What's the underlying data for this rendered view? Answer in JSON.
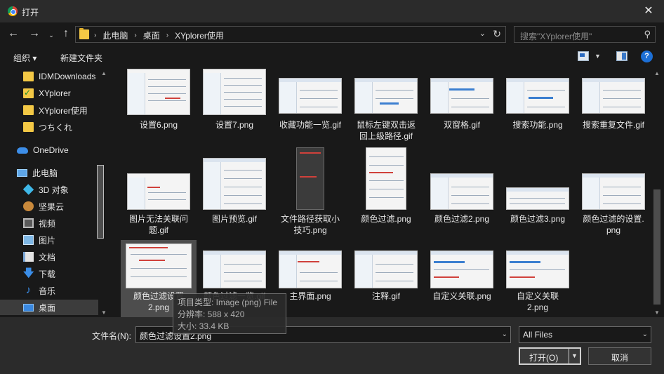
{
  "window": {
    "title": "打开",
    "close_glyph": "✕"
  },
  "nav": {
    "back_glyph": "←",
    "forward_glyph": "→",
    "recent_glyph": "⌄",
    "up_glyph": "↑",
    "breadcrumb": [
      "此电脑",
      "桌面",
      "XYplorer使用"
    ],
    "search_placeholder": "搜索\"XYplorer使用\""
  },
  "toolbar": {
    "organize_label": "组织 ▾",
    "new_folder_label": "新建文件夹",
    "help_glyph": "?"
  },
  "sidebar": {
    "items": [
      {
        "label": "IDMDownloads",
        "icon": "folder-icon"
      },
      {
        "label": "XYplorer",
        "icon": "folder-check-icon"
      },
      {
        "label": "XYplorer使用",
        "icon": "folder-icon"
      },
      {
        "label": "つちくれ",
        "icon": "folder-icon"
      },
      {
        "label": "OneDrive",
        "icon": "cloud-icon"
      },
      {
        "label": "此电脑",
        "icon": "computer-icon"
      },
      {
        "label": "3D 对象",
        "icon": "cube-icon"
      },
      {
        "label": "坚果云",
        "icon": "nut-icon"
      },
      {
        "label": "视频",
        "icon": "video-icon"
      },
      {
        "label": "图片",
        "icon": "picture-icon"
      },
      {
        "label": "文档",
        "icon": "document-icon"
      },
      {
        "label": "下载",
        "icon": "download-icon"
      },
      {
        "label": "音乐",
        "icon": "music-icon"
      },
      {
        "label": "桌面",
        "icon": "desktop-icon"
      }
    ]
  },
  "files": {
    "items": [
      {
        "label1": "设置6.png",
        "label2": ""
      },
      {
        "label1": "设置7.png",
        "label2": ""
      },
      {
        "label1": "收藏功能一览.gif",
        "label2": ""
      },
      {
        "label1": "鼠标左键双击返",
        "label2": "回上级路径.gif"
      },
      {
        "label1": "双窗格.gif",
        "label2": ""
      },
      {
        "label1": "搜索功能.png",
        "label2": ""
      },
      {
        "label1": "搜索重复文件.gif",
        "label2": ""
      },
      {
        "label1": "图片无法关联问",
        "label2": "题.gif"
      },
      {
        "label1": "图片预览.gif",
        "label2": ""
      },
      {
        "label1": "文件路径获取小",
        "label2": "技巧.png"
      },
      {
        "label1": "颜色过滤.png",
        "label2": ""
      },
      {
        "label1": "颜色过滤2.png",
        "label2": ""
      },
      {
        "label1": "颜色过滤3.png",
        "label2": ""
      },
      {
        "label1": "颜色过滤的设置.",
        "label2": "png"
      },
      {
        "label1": "颜色过滤设置",
        "label2": "2.png"
      },
      {
        "label1": "颜色过滤一览.gif",
        "label2": ""
      },
      {
        "label1": "主界面.png",
        "label2": ""
      },
      {
        "label1": "注释.gif",
        "label2": ""
      },
      {
        "label1": "自定义关联.png",
        "label2": ""
      },
      {
        "label1": "自定义关联",
        "label2": "2.png"
      }
    ]
  },
  "tooltip": {
    "line1": "项目类型: Image (png) File",
    "line2": "分辨率: 588 x 420",
    "line3": "大小: 33.4 KB"
  },
  "bottom": {
    "filename_label": "文件名(N):",
    "filename_value": "颜色过滤设置2.png",
    "filetype_value": "All Files",
    "open_label": "打开(O)",
    "cancel_label": "取消"
  }
}
